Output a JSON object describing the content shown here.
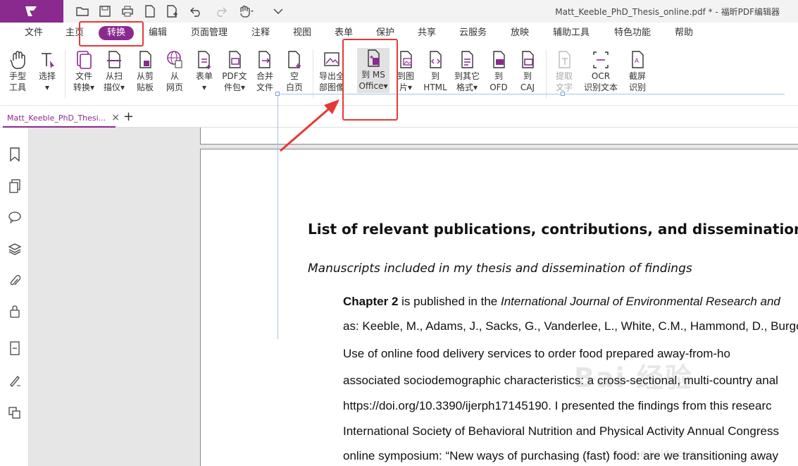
{
  "window": {
    "title": "Matt_Keeble_PhD_Thesis_online.pdf * - 福昕PDF编辑器"
  },
  "quick_access": [
    "open-icon",
    "save-icon",
    "print-icon",
    "new-icon",
    "add-icon",
    "undo-icon",
    "redo-icon",
    "hand-icon",
    "customize-icon"
  ],
  "menu": {
    "items": [
      "文件",
      "主页",
      "转换",
      "编辑",
      "页面管理",
      "注释",
      "视图",
      "表单",
      "保护",
      "共享",
      "云服务",
      "放映",
      "辅助工具",
      "特色功能",
      "帮助"
    ],
    "active": "转换"
  },
  "ribbon": [
    {
      "l1": "手型",
      "l2": "工具"
    },
    {
      "l1": "选择",
      "l2": "▾"
    },
    {
      "l1": "文件",
      "l2": "转换▾"
    },
    {
      "l1": "从扫",
      "l2": "描仪▾"
    },
    {
      "l1": "从剪",
      "l2": "贴板"
    },
    {
      "l1": "从",
      "l2": "网页"
    },
    {
      "l1": "表单",
      "l2": "▾"
    },
    {
      "l1": "PDF文",
      "l2": "件包▾"
    },
    {
      "l1": "合并",
      "l2": "文件"
    },
    {
      "l1": "空",
      "l2": "白页"
    },
    {
      "l1": "导出全",
      "l2": "部图像"
    },
    {
      "l1": "到 MS",
      "l2": "Office▾"
    },
    {
      "l1": "到图",
      "l2": "片▾"
    },
    {
      "l1": "到",
      "l2": "HTML"
    },
    {
      "l1": "到其它",
      "l2": "格式▾"
    },
    {
      "l1": "到",
      "l2": "OFD"
    },
    {
      "l1": "到",
      "l2": "CAJ"
    },
    {
      "l1": "提取",
      "l2": "文字"
    },
    {
      "l1": "OCR",
      "l2": "识别文本"
    },
    {
      "l1": "截屏",
      "l2": "识别"
    }
  ],
  "tabs": {
    "doc": "Matt_Keeble_PhD_Thesi...",
    "close": "×",
    "add": "+"
  },
  "document": {
    "heading": "List of relevant publications, contributions, and dissemination",
    "subheading": "Manuscripts included in my thesis and dissemination of findings",
    "chapter_bold": "Chapter 2",
    "line1_rest": " is published in the ",
    "line1_italic": "International Journal of Environmental Research and",
    "line2": "as: Keeble, M., Adams, J., Sacks, G., Vanderlee, L., White, C.M., Hammond, D., Burgo",
    "line3": "Use of online food delivery services to order food prepared away-from-ho",
    "line4": "associated sociodemographic characteristics: a cross-sectional, multi-country anal",
    "line5": "https://doi.org/10.3390/ijerph17145190. I presented the findings from this researc",
    "line6": "International Society of Behavioral Nutrition and Physical Activity Annual Congress",
    "line7": "online symposium: “New ways of purchasing (fast) food: are we transitioning away"
  },
  "watermark": {
    "main": "Bai 经验",
    "sub": "jingyan.baidu.com"
  },
  "colors": {
    "brand": "#8a2a8f",
    "highlight": "#e53935"
  }
}
